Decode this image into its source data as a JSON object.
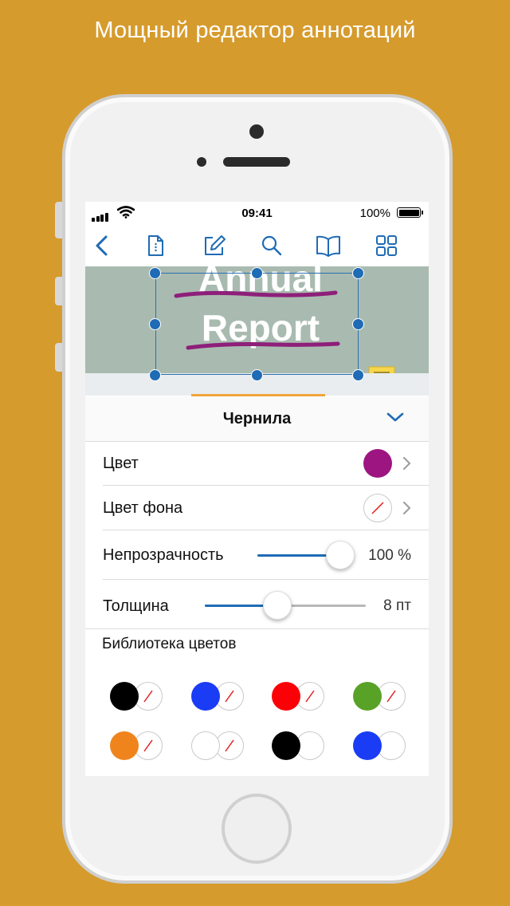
{
  "headline": "Мощный редактор аннотаций",
  "status_bar": {
    "time": "09:41",
    "battery": "100%"
  },
  "toolbar": {
    "icons": [
      "back-chevron-icon",
      "document-info-icon",
      "edit-pen-icon",
      "search-icon",
      "book-icon",
      "grid-icon"
    ]
  },
  "document": {
    "title_line1": "Annual",
    "title_line2": "Report",
    "ink_color": "#8e1f7a"
  },
  "panel": {
    "title": "Чернила",
    "color_label": "Цвет",
    "color_value": "#9c1581",
    "bg_color_label": "Цвет фона",
    "opacity_label": "Непрозрачность",
    "opacity_value": "100 %",
    "opacity_fraction": 1.0,
    "thickness_label": "Толщина",
    "thickness_value": "8 пт",
    "thickness_fraction": 0.45,
    "library_label": "Библиотека цветов",
    "library": [
      {
        "fg": "#000000",
        "bg": "none"
      },
      {
        "fg": "#1a3cf5",
        "bg": "none"
      },
      {
        "fg": "#fb0007",
        "bg": "none"
      },
      {
        "fg": "#58a227",
        "bg": "none"
      },
      {
        "fg": "#f0841c",
        "bg": "none"
      },
      {
        "fg": "#ffffff",
        "bg": "none"
      },
      {
        "fg": "#000000",
        "bg": "#ffffff"
      },
      {
        "fg": "#1a3cf5",
        "bg": "#ffffff"
      }
    ]
  },
  "accent_color": "#1f6bb5"
}
